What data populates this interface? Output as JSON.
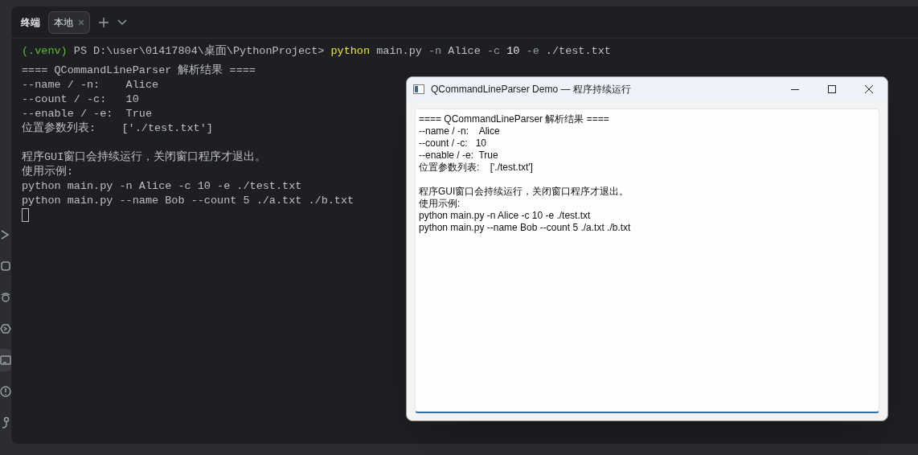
{
  "tool_window": {
    "title": "终端",
    "tabs": [
      {
        "label": "本地",
        "selected": true
      }
    ]
  },
  "terminal": {
    "prompt": [
      {
        "kind": "venv",
        "text": "(.venv)"
      },
      {
        "kind": "path",
        "text": " PS D:\\user\\01417804\\桌面\\PythonProject> "
      },
      {
        "kind": "command",
        "text": "python"
      },
      {
        "kind": "arg",
        "text": " main.py "
      },
      {
        "kind": "flag",
        "text": "-n"
      },
      {
        "kind": "arg",
        "text": " Alice "
      },
      {
        "kind": "flag",
        "text": "-c "
      },
      {
        "kind": "number",
        "text": "10 "
      },
      {
        "kind": "flag",
        "text": "-e"
      },
      {
        "kind": "arg",
        "text": " ./test.txt"
      }
    ],
    "output": [
      {
        "kind": "text",
        "text": "==== QCommandLineParser 解析结果 ===="
      },
      {
        "kind": "text",
        "text": "--name / -n:    Alice"
      },
      {
        "kind": "text",
        "text": "--count / -c:   10"
      },
      {
        "kind": "text",
        "text": "--enable / -e:  True"
      },
      {
        "kind": "text",
        "text": "位置参数列表:    ['./test.txt']"
      },
      {
        "kind": "blank"
      },
      {
        "kind": "text",
        "text": "程序GUI窗口会持续运行，关闭窗口程序才退出。"
      },
      {
        "kind": "text",
        "text": "使用示例:"
      },
      {
        "kind": "text",
        "text": "python main.py -n Alice -c 10 -e ./test.txt"
      },
      {
        "kind": "text",
        "text": "python main.py --name Bob --count 5 ./a.txt ./b.txt"
      }
    ],
    "cursor": true
  },
  "demo_window": {
    "title": "QCommandLineParser Demo — 程序持续运行",
    "lines": [
      {
        "kind": "text",
        "text": "==== QCommandLineParser 解析结果 ===="
      },
      {
        "kind": "text",
        "text": "--name / -n:    Alice"
      },
      {
        "kind": "text",
        "text": "--count / -c:   10"
      },
      {
        "kind": "text",
        "text": "--enable / -e:  True"
      },
      {
        "kind": "text",
        "text": "位置参数列表:    ['./test.txt']"
      },
      {
        "kind": "blank"
      },
      {
        "kind": "text",
        "text": "程序GUI窗口会持续运行，关闭窗口程序才退出。"
      },
      {
        "kind": "text",
        "text": "使用示例:"
      },
      {
        "kind": "text",
        "text": "python main.py -n Alice -c 10 -e ./test.txt"
      },
      {
        "kind": "text",
        "text": "python main.py --name Bob --count 5 ./a.txt ./b.txt"
      }
    ]
  }
}
